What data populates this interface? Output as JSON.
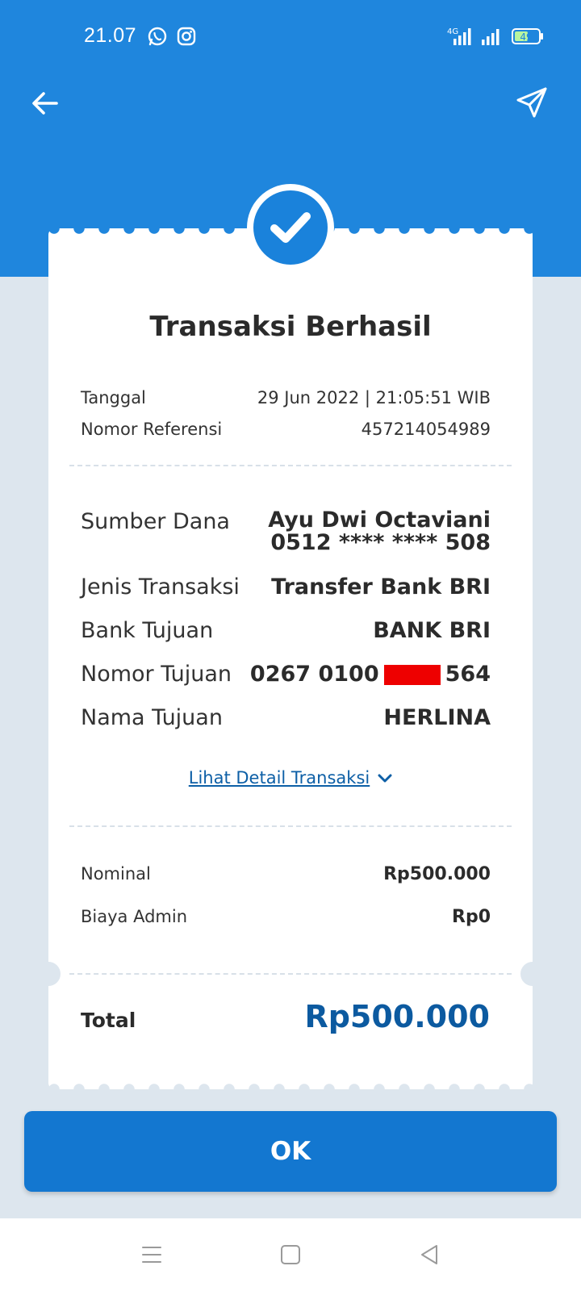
{
  "status_bar": {
    "time": "21.07",
    "battery": "49",
    "network": "4G"
  },
  "header": {
    "back_icon": "arrow-left-icon",
    "share_icon": "send-icon"
  },
  "receipt": {
    "title": "Transaksi Berhasil",
    "tanggal_label": "Tanggal",
    "tanggal_value": "29 Jun 2022 | 21:05:51 WIB",
    "referensi_label": "Nomor Referensi",
    "referensi_value": "457214054989",
    "sumber_label": "Sumber Dana",
    "sumber_name": "Ayu Dwi Octaviani",
    "sumber_account": "0512 **** **** 508",
    "jenis_label": "Jenis Transaksi",
    "jenis_value": "Transfer Bank BRI",
    "bank_label": "Bank Tujuan",
    "bank_value": "BANK BRI",
    "nomor_label": "Nomor Tujuan",
    "nomor_prefix": "0267 0100",
    "nomor_suffix": "564",
    "nama_label": "Nama Tujuan",
    "nama_value": "HERLINA",
    "detail_link": "Lihat Detail Transaksi",
    "nominal_label": "Nominal",
    "nominal_value": "Rp500.000",
    "admin_label": "Biaya Admin",
    "admin_value": "Rp0",
    "total_label": "Total",
    "total_value": "Rp500.000"
  },
  "ok_button": "OK",
  "colors": {
    "header": "#1f86dd",
    "accent": "#0c5aa0",
    "button": "#1377d0",
    "background": "#dde6ee",
    "redaction": "#ee0000"
  }
}
